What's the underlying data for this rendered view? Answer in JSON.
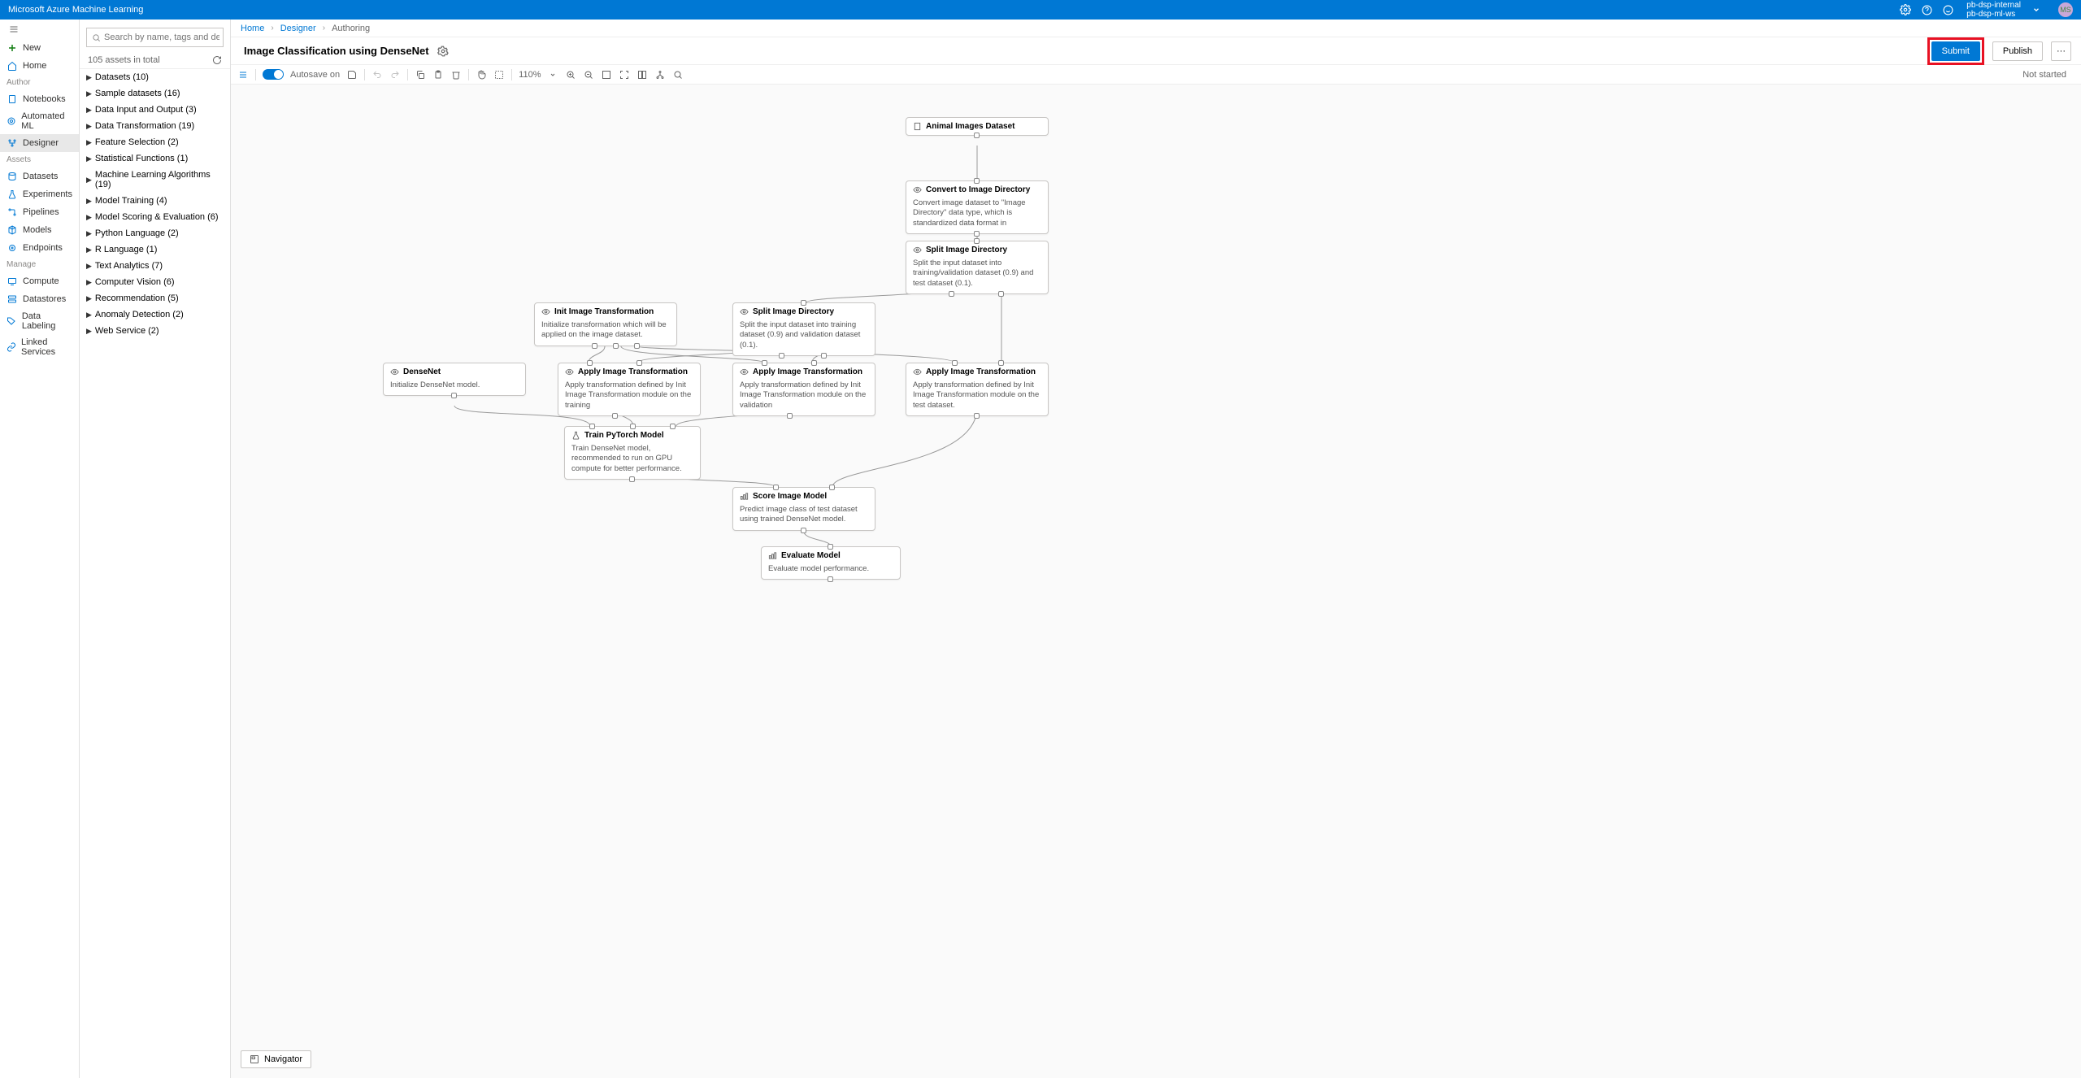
{
  "topbar": {
    "title": "Microsoft Azure Machine Learning",
    "workspace_line1": "pb-dsp-internal",
    "workspace_line2": "pb-dsp-ml-ws",
    "avatar": "MS"
  },
  "left_nav": {
    "new": "New",
    "home": "Home",
    "author": "Author",
    "notebooks": "Notebooks",
    "automl": "Automated ML",
    "designer": "Designer",
    "assets": "Assets",
    "datasets": "Datasets",
    "experiments": "Experiments",
    "pipelines": "Pipelines",
    "models": "Models",
    "endpoints": "Endpoints",
    "manage": "Manage",
    "compute": "Compute",
    "datastores": "Datastores",
    "data_labeling": "Data Labeling",
    "linked_services": "Linked Services"
  },
  "asset_panel": {
    "search_placeholder": "Search by name, tags and description",
    "total": "105 assets in total",
    "groups": [
      "Datasets (10)",
      "Sample datasets (16)",
      "Data Input and Output (3)",
      "Data Transformation (19)",
      "Feature Selection (2)",
      "Statistical Functions (1)",
      "Machine Learning Algorithms (19)",
      "Model Training (4)",
      "Model Scoring & Evaluation (6)",
      "Python Language (2)",
      "R Language (1)",
      "Text Analytics (7)",
      "Computer Vision (6)",
      "Recommendation (5)",
      "Anomaly Detection (2)",
      "Web Service (2)"
    ]
  },
  "breadcrumb": {
    "home": "Home",
    "designer": "Designer",
    "authoring": "Authoring"
  },
  "page_header": {
    "title": "Image Classification using DenseNet",
    "submit": "Submit",
    "publish": "Publish"
  },
  "toolbar": {
    "autosave": "Autosave on",
    "zoom": "110%",
    "status": "Not started",
    "navigator": "Navigator"
  },
  "nodes": {
    "dataset": {
      "title": "Animal Images Dataset"
    },
    "convert": {
      "title": "Convert to Image Directory",
      "desc": "Convert image dataset to \"Image Directory\" data type, which is standardized data format in"
    },
    "split1": {
      "title": "Split Image Directory",
      "desc": "Split the input dataset into training/validation dataset (0.9) and test dataset (0.1)."
    },
    "init": {
      "title": "Init Image Transformation",
      "desc": "Initialize transformation which will be applied on the image dataset."
    },
    "split2": {
      "title": "Split Image Directory",
      "desc": "Split the input dataset into training dataset (0.9) and validation dataset (0.1)."
    },
    "densenet": {
      "title": "DenseNet",
      "desc": "Initialize DenseNet model."
    },
    "apply1": {
      "title": "Apply Image Transformation",
      "desc": "Apply transformation defined by Init Image Transformation module on the training"
    },
    "apply2": {
      "title": "Apply Image Transformation",
      "desc": "Apply transformation defined by Init Image Transformation module on the validation"
    },
    "apply3": {
      "title": "Apply Image Transformation",
      "desc": "Apply transformation defined by Init Image Transformation module on the test dataset."
    },
    "train": {
      "title": "Train PyTorch Model",
      "desc": "Train DenseNet model, recommended to run on GPU compute for better performance."
    },
    "score": {
      "title": "Score Image Model",
      "desc": "Predict image class of test dataset using trained DenseNet model."
    },
    "eval": {
      "title": "Evaluate Model",
      "desc": "Evaluate model performance."
    }
  }
}
